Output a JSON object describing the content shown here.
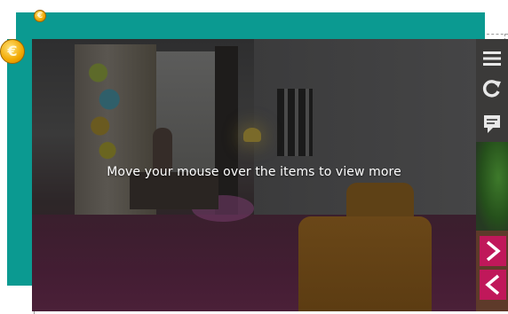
{
  "scene": {
    "overlay_message": "Move your mouse over the items to view more"
  },
  "coins": {
    "small_symbol": "€",
    "large_symbol": "€"
  },
  "toolbar": {
    "menu_icon": "menu-icon",
    "reload_icon": "reload-icon",
    "chat_icon": "chat-icon",
    "next_icon": "chevron-right-icon",
    "previous_icon": "chevron-left-icon"
  },
  "colors": {
    "frame_teal": "#0b9a91",
    "nav_accent": "#c0185a",
    "coin_gold": "#f2a800"
  }
}
